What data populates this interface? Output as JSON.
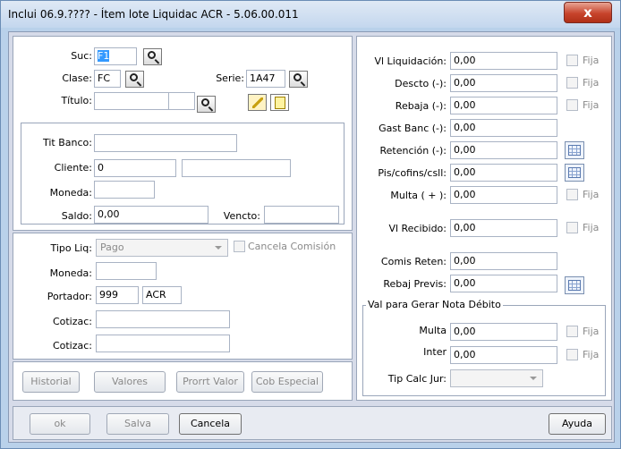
{
  "window": {
    "title": "Inclui 06.9.???? - Ítem lote Liquidac ACR - 5.06.00.011",
    "close_label": "x"
  },
  "left": {
    "suc": {
      "label": "Suc:",
      "value": "F1"
    },
    "clase": {
      "label": "Clase:",
      "value": "FC"
    },
    "serie": {
      "label": "Serie:",
      "value": "1A47"
    },
    "titulo": {
      "label": "Título:",
      "value": ""
    },
    "tit_banco": {
      "label": "Tit Banco:",
      "value": ""
    },
    "cliente": {
      "label": "Cliente:",
      "value": "0",
      "name_value": ""
    },
    "moneda1": {
      "label": "Moneda:",
      "value": ""
    },
    "saldo": {
      "label": "Saldo:",
      "value": "0,00"
    },
    "vencto": {
      "label": "Vencto:",
      "value": ""
    },
    "tipo_liq": {
      "label": "Tipo Liq:",
      "value": "Pago"
    },
    "cancela_comision": {
      "label": "Cancela Comisión"
    },
    "moneda2": {
      "label": "Moneda:",
      "value": ""
    },
    "portador": {
      "label": "Portador:",
      "value": "999",
      "code": "ACR"
    },
    "cotizac1": {
      "label": "Cotizac:",
      "value": ""
    },
    "cotizac2": {
      "label": "Cotizac:",
      "value": ""
    },
    "buttons": {
      "historial": "Historial",
      "valores": "Valores",
      "prorrt_valor": "Prorrt Valor",
      "cob_especial": "Cob Especial"
    }
  },
  "right": {
    "vl_liquidacion": {
      "label": "Vl Liquidación:",
      "value": "0,00",
      "fija": "Fija"
    },
    "descto": {
      "label": "Descto (-):",
      "value": "0,00",
      "fija": "Fija"
    },
    "rebaja": {
      "label": "Rebaja (-):",
      "value": "0,00",
      "fija": "Fija"
    },
    "gast_banc": {
      "label": "Gast Banc (-):",
      "value": "0,00"
    },
    "retencion": {
      "label": "Retención (-):",
      "value": "0,00"
    },
    "pis_cofins": {
      "label": "Pis/cofins/csll:",
      "value": "0,00"
    },
    "multa": {
      "label": "Multa ( + ):",
      "value": "0,00",
      "fija": "Fija"
    },
    "vl_recibido": {
      "label": "Vl Recibido:",
      "value": "0,00",
      "fija": "Fija"
    },
    "comis_reten": {
      "label": "Comis Reten:",
      "value": "0,00"
    },
    "rebaj_previs": {
      "label": "Rebaj Previs:",
      "value": "0,00"
    },
    "nota_debito": {
      "title": "Val para Gerar Nota Débito",
      "multa": {
        "label": "Multa",
        "value": "0,00",
        "fija": "Fija"
      },
      "inter": {
        "label": "Inter",
        "value": "0,00",
        "fija": "Fija"
      },
      "tip_calc_jur": {
        "label": "Tip Calc Jur:",
        "value": ""
      }
    }
  },
  "footer": {
    "ok": "ok",
    "salva": "Salva",
    "cancela": "Cancela",
    "ayuda": "Ayuda"
  }
}
